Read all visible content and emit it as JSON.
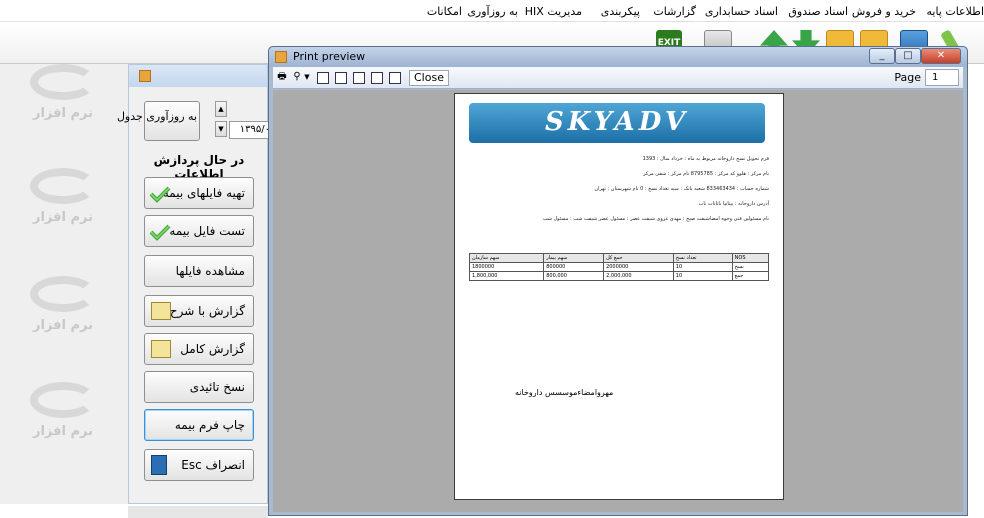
{
  "menu": {
    "items": [
      "اطلاعات پایه",
      "خرید و فروش",
      "اسناد صندوق",
      "اسناد حسابداری",
      "گزارشات",
      "پیکربندی",
      "مدیریت HIX",
      "به روزآوری",
      "امکانات"
    ]
  },
  "toolbar": {
    "exit_label": "EXIT"
  },
  "side_panel": {
    "refresh_table_label": "به روزآوری جدول",
    "date_value": "۱۳۹۵/۰",
    "status_label": "در حال پردازش اطلاعات",
    "buttons": [
      {
        "label": "تهیه فایلهای بیمه",
        "icon": "check-icon"
      },
      {
        "label": "تست فایل بیمه",
        "icon": "check-icon"
      },
      {
        "label": "مشاهده فایلها",
        "icon": ""
      },
      {
        "label": "گزارش با شرح",
        "icon": "notepad-icon"
      },
      {
        "label": "گزارش کامل",
        "icon": "notepad-icon"
      },
      {
        "label": "نسخ تائیدی",
        "icon": ""
      },
      {
        "label": "چاپ فرم بیمه",
        "icon": ""
      },
      {
        "label": "انصراف Esc",
        "icon": "exit-door-icon"
      }
    ]
  },
  "print_preview": {
    "title": "Print preview",
    "close_label": "Close",
    "page_label": "Page",
    "page_value": "1",
    "document": {
      "banner_text": "SKYADV",
      "lines": [
        "فرم تحویل نسخ داروخانه مربوط به ماه : خرداد  سال : 1393",
        "نام مرکز : هلوو  کد مرکز : 8795785  نام مرکز : شفی مرکز",
        "شماره حساب : 833463434  شعبه بانک : سپه  تعداد نسخ : 0  نام شهرستان : تهران",
        "آدرس داروخانه : بیتاتیا ناتانات ناب",
        "نام مسئولین فنی وجوه امضاشیفت صبح : مهدی غزوی شیفت عصر : مسئول عصر شیفت شب : مسئول شب"
      ],
      "table": {
        "headers": [
          "سهم سازمان",
          "سهم بیمار",
          "جمع کل",
          "تعداد نسخ",
          "NOS"
        ],
        "rows": [
          [
            "1800000",
            "800000",
            "2000000",
            "10",
            "نسخ"
          ],
          [
            "1,800,000",
            "800,000",
            "2,000,000",
            "10",
            "جمع"
          ]
        ]
      },
      "signature": "مهروامضاءموسسس داروخانه"
    }
  },
  "watermark_text": "نرم افزار"
}
